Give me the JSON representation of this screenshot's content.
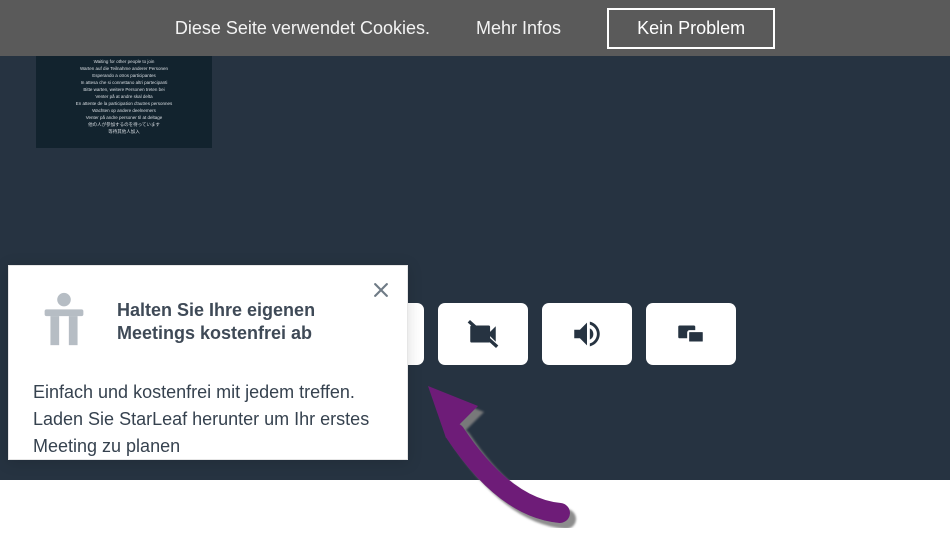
{
  "cookie_bar": {
    "text": "Diese Seite verwendet Cookies.",
    "more": "Mehr Infos",
    "accept": "Kein Problem"
  },
  "thumb": {
    "lines": [
      "Waiting for other people to join",
      "Warten auf die Teilnahme anderer Personen",
      "Esperando a otros participantes",
      "In attesa che si connettano altri partecipanti",
      "Bitte warten, weitere Personen treten bei",
      "Venter på at andre skal delta",
      "En attente de la participation d'autres personnes",
      "Wachten op andere deelnemers",
      "Venter på andre personer til at deltage",
      "他の人が参加するのを待っています",
      "等待其他人加入"
    ]
  },
  "controls": {
    "mic": "microphone-button",
    "cam": "camera-off-button",
    "vol": "volume-button",
    "share": "screen-share-button"
  },
  "popup": {
    "title": "Halten Sie Ihre eigenen Meetings kostenfrei ab",
    "body": "Einfach und kostenfrei mit jedem treffen. Laden Sie StarLeaf herunter um Ihr erstes Meeting zu planen"
  }
}
